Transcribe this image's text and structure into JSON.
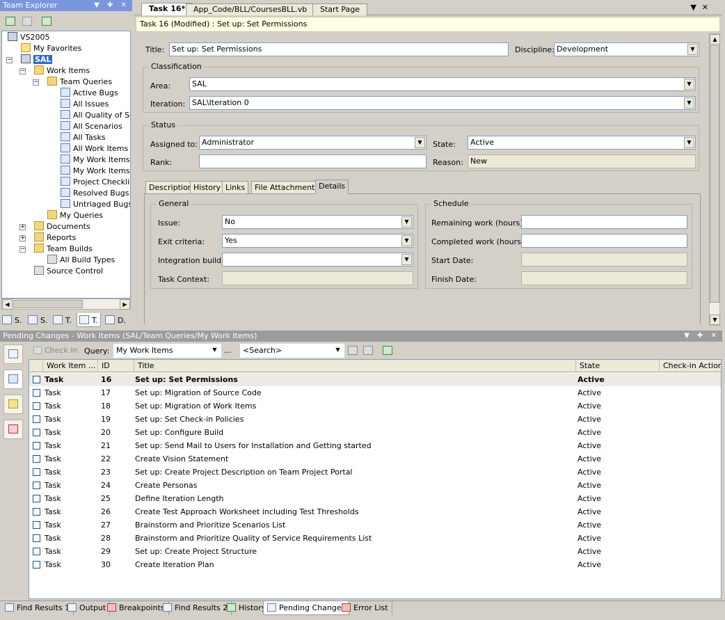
{
  "team_explorer": {
    "title": "Team Explorer",
    "tree": {
      "server": "VS2005",
      "favorites": "My Favorites",
      "project": "SAL",
      "work_items": "Work Items",
      "team_queries": "Team Queries",
      "queries": [
        "Active Bugs",
        "All Issues",
        "All Quality of Ser",
        "All Scenarios",
        "All Tasks",
        "All Work Items",
        "My Work Items",
        "My Work Items f",
        "Project Checklist",
        "Resolved Bugs",
        "Untriaged Bugs"
      ],
      "my_queries": "My Queries",
      "documents": "Documents",
      "reports": "Reports",
      "team_builds": "Team Builds",
      "all_build_types": "All Build Types",
      "source_control": "Source Control"
    },
    "bottom_tabs": [
      "S.",
      "S.",
      "T.",
      "T.",
      "D."
    ]
  },
  "doc_tabs": [
    "Task 16*",
    "App_Code/BLL/CoursesBLL.vb",
    "Start Page"
  ],
  "form": {
    "header": "Task 16 (Modified) : Set up: Set Permissions",
    "title_label": "Title:",
    "title_value": "Set up: Set Permissions",
    "discipline_label": "Discipline:",
    "discipline_value": "Development",
    "classification_label": "Classification",
    "area_label": "Area:",
    "area_value": "SAL",
    "iteration_label": "Iteration:",
    "iteration_value": "SAL\\Iteration 0",
    "status_label": "Status",
    "assigned_label": "Assigned to:",
    "assigned_value": "Administrator",
    "state_label": "State:",
    "state_value": "Active",
    "rank_label": "Rank:",
    "rank_value": "",
    "reason_label": "Reason:",
    "reason_value": "New",
    "tabs": [
      "Description",
      "History",
      "Links",
      "File Attachments",
      "Details"
    ],
    "general_label": "General",
    "issue_label": "Issue:",
    "issue_value": "No",
    "exit_label": "Exit criteria:",
    "exit_value": "Yes",
    "integration_label": "Integration build:",
    "integration_value": "",
    "task_context_label": "Task Context:",
    "schedule_label": "Schedule",
    "remaining_label": "Remaining work (hours):",
    "completed_label": "Completed work (hours):",
    "start_label": "Start Date:",
    "finish_label": "Finish Date:"
  },
  "pending": {
    "title": "Pending Changes - Work Items (SAL/Team Queries/My Work Items)",
    "checkin": "Check In",
    "query_label": "Query:",
    "query_value": "My Work Items",
    "ellipsis": "...",
    "search_placeholder": "<Search>",
    "columns": [
      "Work Item ...",
      "ID",
      "Title",
      "State",
      "Check-in Action"
    ],
    "rows": [
      {
        "type": "Task",
        "id": "16",
        "title": "Set up: Set Permissions",
        "state": "Active"
      },
      {
        "type": "Task",
        "id": "17",
        "title": "Set up: Migration of Source Code",
        "state": "Active"
      },
      {
        "type": "Task",
        "id": "18",
        "title": "Set up: Migration of Work Items",
        "state": "Active"
      },
      {
        "type": "Task",
        "id": "19",
        "title": "Set up: Set Check-in Policies",
        "state": "Active"
      },
      {
        "type": "Task",
        "id": "20",
        "title": "Set up: Configure Build",
        "state": "Active"
      },
      {
        "type": "Task",
        "id": "21",
        "title": "Set up: Send Mail to Users for Installation and Getting started",
        "state": "Active"
      },
      {
        "type": "Task",
        "id": "22",
        "title": "Create Vision Statement",
        "state": "Active"
      },
      {
        "type": "Task",
        "id": "23",
        "title": "Set up: Create Project Description on Team Project Portal",
        "state": "Active"
      },
      {
        "type": "Task",
        "id": "24",
        "title": "Create Personas",
        "state": "Active"
      },
      {
        "type": "Task",
        "id": "25",
        "title": "Define Iteration Length",
        "state": "Active"
      },
      {
        "type": "Task",
        "id": "26",
        "title": "Create Test Approach Worksheet including Test Thresholds",
        "state": "Active"
      },
      {
        "type": "Task",
        "id": "27",
        "title": "Brainstorm and Prioritize Scenarios List",
        "state": "Active"
      },
      {
        "type": "Task",
        "id": "28",
        "title": "Brainstorm and Prioritize Quality of Service Requirements List",
        "state": "Active"
      },
      {
        "type": "Task",
        "id": "29",
        "title": "Set up: Create Project Structure",
        "state": "Active"
      },
      {
        "type": "Task",
        "id": "30",
        "title": "Create Iteration Plan",
        "state": "Active"
      }
    ]
  },
  "bottom_tabs": [
    "Find Results 1",
    "Output",
    "Breakpoints",
    "Find Results 2",
    "History",
    "Pending Changes",
    "Error List"
  ]
}
